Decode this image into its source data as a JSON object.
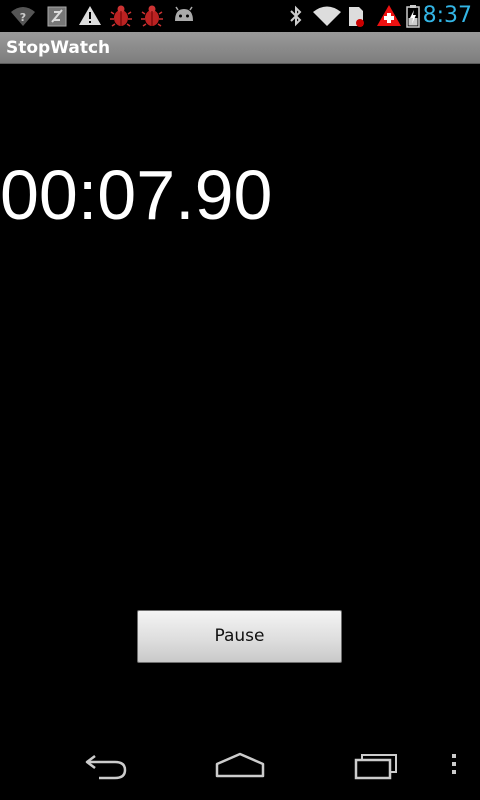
{
  "status_bar": {
    "time": "8:37",
    "time_color": "#33b5e5",
    "icons": [
      "wifi-question-icon",
      "usb-debug-icon",
      "warning-icon",
      "bug-icon",
      "bug-icon",
      "android-icon",
      "bluetooth-icon",
      "wifi-icon",
      "sd-card-icon",
      "alert-plus-icon",
      "battery-charging-icon"
    ]
  },
  "app": {
    "title": "StopWatch"
  },
  "timer": {
    "display": "00:07.90"
  },
  "controls": {
    "pause_label": "Pause"
  },
  "nav_bar": {
    "icons": [
      "back-icon",
      "home-icon",
      "recent-apps-icon",
      "menu-icon"
    ]
  }
}
